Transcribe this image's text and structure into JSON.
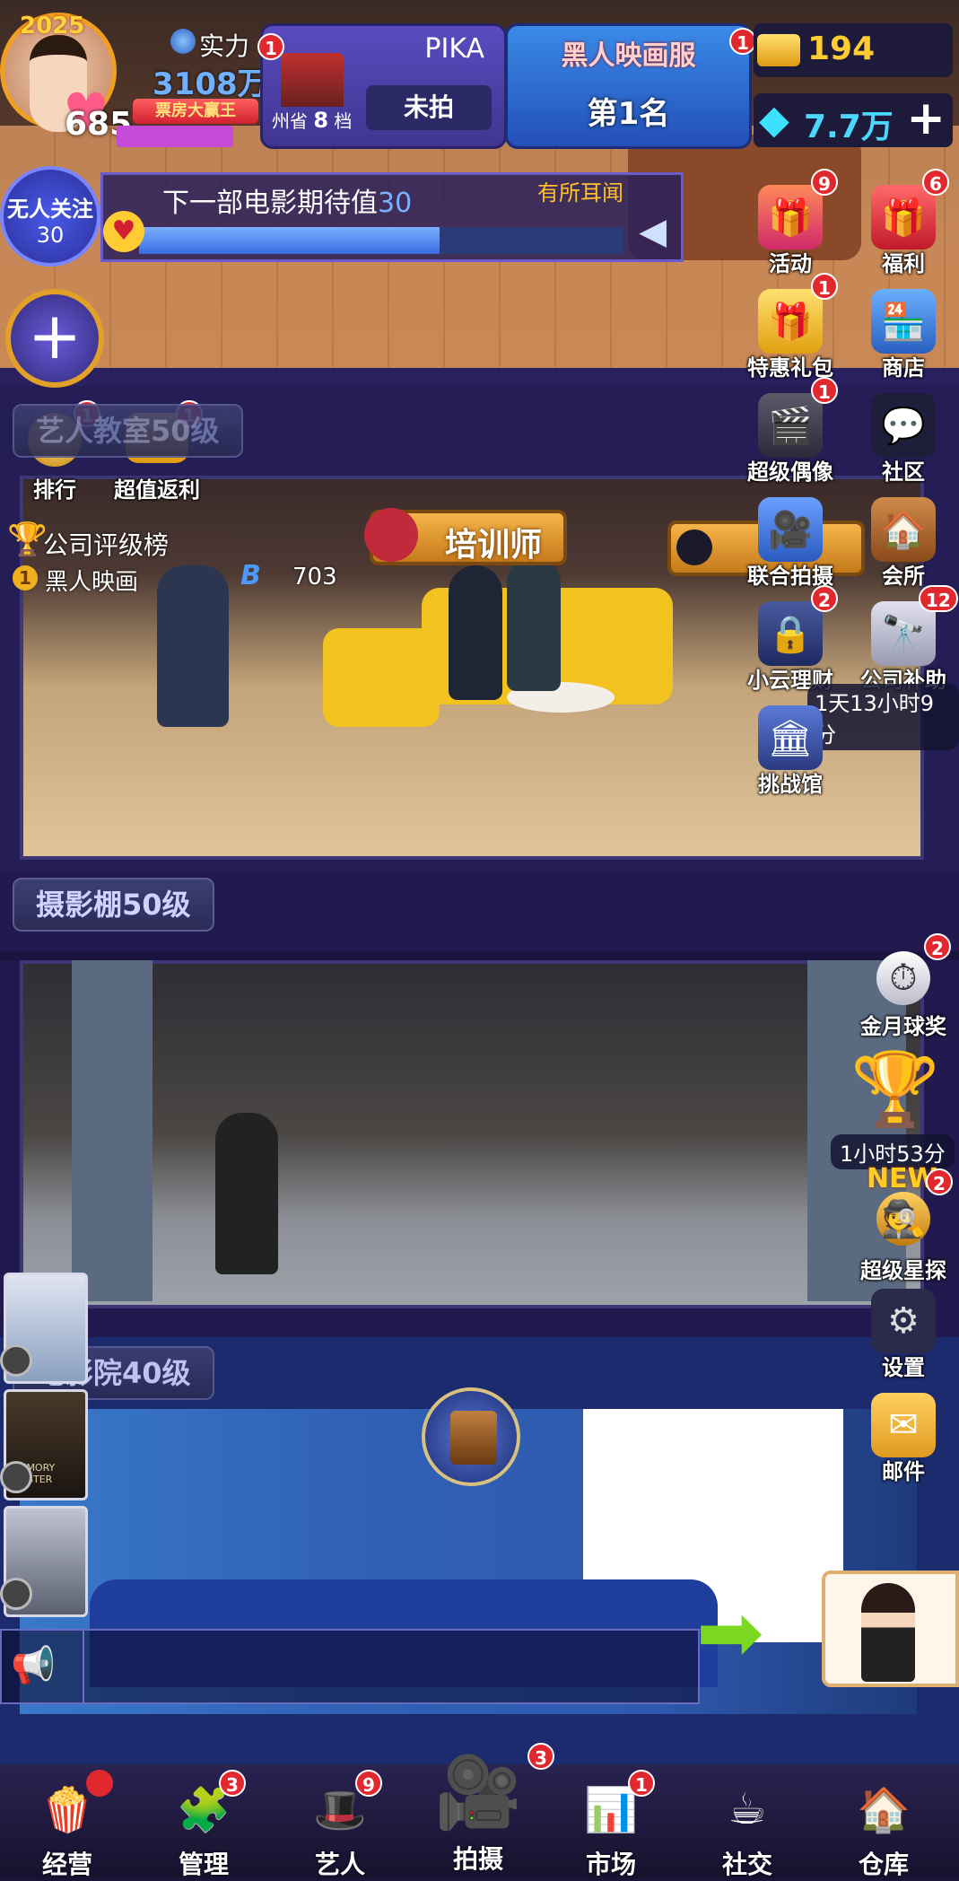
{
  "player": {
    "year": "2025",
    "power_label": "实力",
    "power_value": "3108万",
    "hearts": "685",
    "title_badge": "票房大赢王"
  },
  "studio_card": {
    "name": "PIKA",
    "region": "州省",
    "slot_num": "8",
    "slot_unit": "档",
    "status": "未拍",
    "badge": "1"
  },
  "server_card": {
    "name": "黑人映画服",
    "rank": "第1名",
    "badge": "1"
  },
  "currency": {
    "gold": "194",
    "diamonds": "7.7万"
  },
  "follow": {
    "label": "无人关注",
    "value": "30"
  },
  "expectation": {
    "text": "下一部电影期待值",
    "value": "30",
    "level": "有所耳闻",
    "progress": 0.62
  },
  "right_menu": [
    {
      "label": "活动",
      "badge": "9",
      "icon": "gift-box-icon"
    },
    {
      "label": "福利",
      "badge": "6",
      "icon": "welfare-gift-icon"
    },
    {
      "label": "特惠礼包",
      "badge": "1",
      "icon": "special-pack-icon"
    },
    {
      "label": "商店",
      "badge": "",
      "icon": "shop-icon"
    },
    {
      "label": "超级偶像",
      "badge": "1",
      "icon": "clapperboard-icon"
    },
    {
      "label": "社区",
      "badge": "",
      "icon": "chat-bubbles-icon"
    },
    {
      "label": "联合拍摄",
      "badge": "",
      "icon": "joint-shoot-icon"
    },
    {
      "label": "会所",
      "badge": "",
      "icon": "clubhouse-icon"
    },
    {
      "label": "小云理财",
      "badge": "2",
      "icon": "safe-icon"
    },
    {
      "label": "公司补助",
      "badge": "12",
      "icon": "telescope-icon"
    },
    {
      "label": "挑战馆",
      "badge": "",
      "icon": "challenge-hall-icon"
    }
  ],
  "subsidy_timer": "1天13小时9分",
  "left_menu": [
    {
      "label": "排行",
      "badge": "1"
    },
    {
      "label": "超值返利",
      "badge": "1"
    }
  ],
  "company_rank": {
    "title": "公司评级榜",
    "rank": "1",
    "company": "黑人映画",
    "grade": "B",
    "score": "703"
  },
  "floors": [
    {
      "label": "艺人教室50级"
    },
    {
      "label": "摄影棚50级"
    },
    {
      "label": "电影院40级"
    }
  ],
  "trainer_sign": "培训师",
  "lower_right_menu": [
    {
      "label": "金月球奖",
      "badge": "2"
    },
    {
      "label": "超级星探",
      "badge": "2",
      "tag": "NEW"
    },
    {
      "label": "设置",
      "badge": ""
    },
    {
      "label": "邮件",
      "badge": ""
    }
  ],
  "trophy_timer": "1小时53分",
  "posters": [
    "poster-1",
    "poster-2",
    "poster-3"
  ],
  "poster2_caption": "MEMORY MASTER",
  "bottom_nav": [
    {
      "label": "经营",
      "badge": "dot"
    },
    {
      "label": "管理",
      "badge": "3"
    },
    {
      "label": "艺人",
      "badge": "9"
    },
    {
      "label": "拍摄",
      "badge": "3"
    },
    {
      "label": "市场",
      "badge": "1"
    },
    {
      "label": "社交",
      "badge": ""
    },
    {
      "label": "仓库",
      "badge": ""
    }
  ],
  "colors": {
    "badge_red": "#e0282e",
    "gold": "#ffcc33",
    "panel_purple": "#3b3a8e",
    "nav_bg": "#1b1633"
  }
}
